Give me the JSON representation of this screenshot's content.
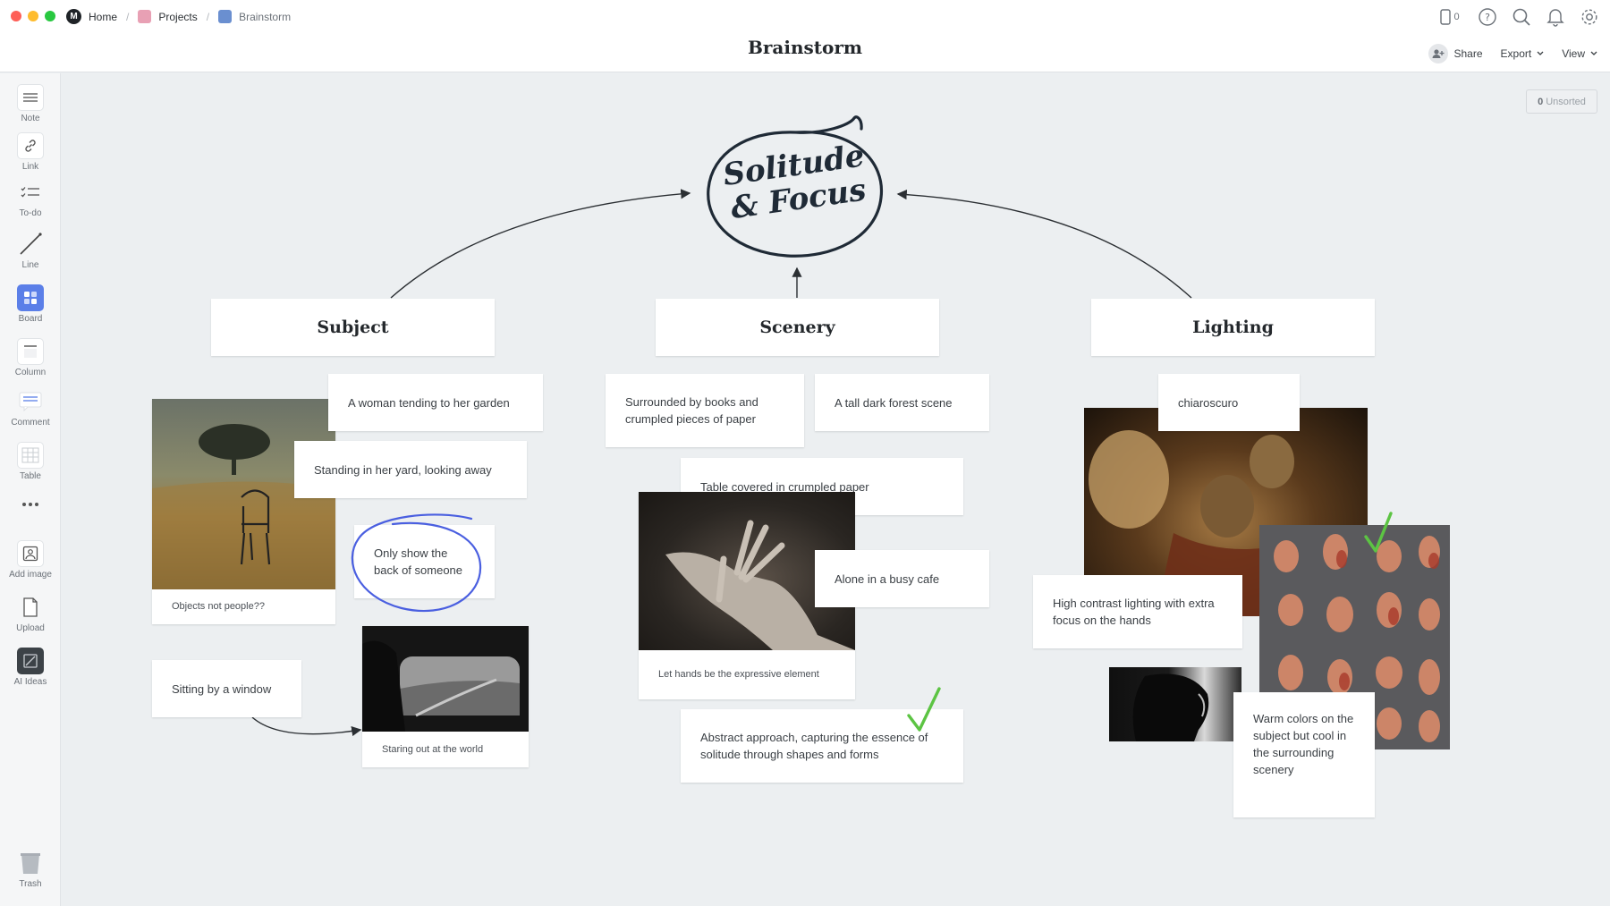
{
  "window": {
    "traffic_colors": [
      "#fe5f57",
      "#febc2e",
      "#28c840"
    ]
  },
  "breadcrumbs": [
    {
      "label": "Home",
      "icon": "milanote-logo-icon"
    },
    {
      "label": "Projects",
      "color": "#e8a0b4"
    },
    {
      "label": "Brainstorm",
      "color": "#6a8fd0"
    }
  ],
  "title": "Brainstorm",
  "header": {
    "device_count": "0",
    "share_label": "Share",
    "export_label": "Export",
    "view_label": "View"
  },
  "sidebar": {
    "tools": [
      {
        "label": "Note",
        "icon": "note-icon"
      },
      {
        "label": "Link",
        "icon": "link-icon"
      },
      {
        "label": "To-do",
        "icon": "todo-icon"
      },
      {
        "label": "Line",
        "icon": "line-icon"
      },
      {
        "label": "Board",
        "icon": "board-icon"
      },
      {
        "label": "Column",
        "icon": "column-icon"
      },
      {
        "label": "Comment",
        "icon": "comment-icon"
      },
      {
        "label": "Table",
        "icon": "table-icon"
      },
      {
        "label": "",
        "icon": "more-icon"
      },
      {
        "label": "Add image",
        "icon": "add-image-icon"
      },
      {
        "label": "Upload",
        "icon": "upload-icon"
      },
      {
        "label": "AI Ideas",
        "icon": "ai-ideas-icon"
      },
      {
        "label": "Trash",
        "icon": "trash-icon"
      }
    ]
  },
  "canvas": {
    "unsorted_count": "0",
    "unsorted_label": "Unsorted",
    "center_title_line1": "Solitude",
    "center_title_line2": "& Focus",
    "columns": {
      "subject": {
        "header": "Subject",
        "notes": {
          "garden": "A woman tending to her garden",
          "yard": "Standing in her yard, looking away",
          "back": "Only show the back of someone",
          "window": "Sitting by a window"
        },
        "captions": {
          "field": "Objects not people??",
          "car": "Staring out at the world"
        }
      },
      "scenery": {
        "header": "Scenery",
        "notes": {
          "books": "Surrounded by books and crumpled pieces of paper",
          "forest": "A tall dark forest scene",
          "table": "Table covered in crumpled paper",
          "cafe": "Alone in a busy cafe",
          "abstract": "Abstract approach, capturing the essence of solitude through shapes and forms"
        },
        "captions": {
          "hand": "Let hands be the expressive element"
        }
      },
      "lighting": {
        "header": "Lighting",
        "notes": {
          "chiaroscuro": "chiaroscuro",
          "contrast": "High contrast lighting with extra focus on the hands",
          "warm": "Warm colors on the subject but cool in the surrounding scenery"
        }
      }
    },
    "accent_colors": {
      "circle_blue": "#4a5fe0",
      "check_green": "#5cc443",
      "board_blue": "#5b7fe8"
    }
  }
}
